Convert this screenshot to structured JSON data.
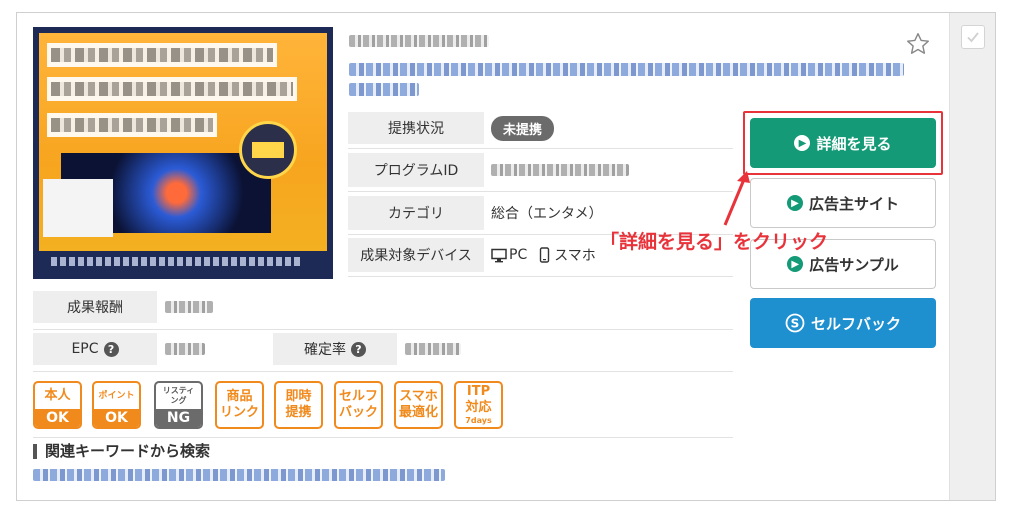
{
  "info": {
    "rows": [
      {
        "label": "提携状況",
        "badge": "未提携"
      },
      {
        "label": "プログラムID"
      },
      {
        "label": "カテゴリ",
        "value": "総合（エンタメ）"
      },
      {
        "label": "成果対象デバイス",
        "device_pc": "PC",
        "device_sp": "スマホ"
      }
    ]
  },
  "metrics": {
    "reward_label": "成果報酬",
    "epc_label": "EPC",
    "confirm_label": "確定率",
    "help_glyph": "?"
  },
  "buttons": {
    "detail": "詳細を見る",
    "advertiser_site": "広告主サイト",
    "ad_sample": "広告サンプル",
    "selfback": "セルフバック"
  },
  "annotation": "「詳細を見る」をクリック",
  "tags": [
    {
      "top": "本人",
      "bottom": "OK"
    },
    {
      "top": "ポイント",
      "bottom": "OK"
    },
    {
      "top": "リスティング",
      "bottom": "NG"
    },
    {
      "line1": "商品",
      "line2": "リンク"
    },
    {
      "line1": "即時",
      "line2": "提携"
    },
    {
      "line1": "セルフ",
      "line2": "バック"
    },
    {
      "line1": "スマホ",
      "line2": "最適化"
    },
    {
      "line1": "ITP",
      "line2": "対応",
      "line3": "7days"
    }
  ],
  "keywords": {
    "title": "関連キーワードから検索"
  },
  "colors": {
    "accent_green": "#149a76",
    "accent_blue": "#1e8fcf",
    "tag_orange": "#f08a1d",
    "annotation_red": "#e8333b"
  }
}
